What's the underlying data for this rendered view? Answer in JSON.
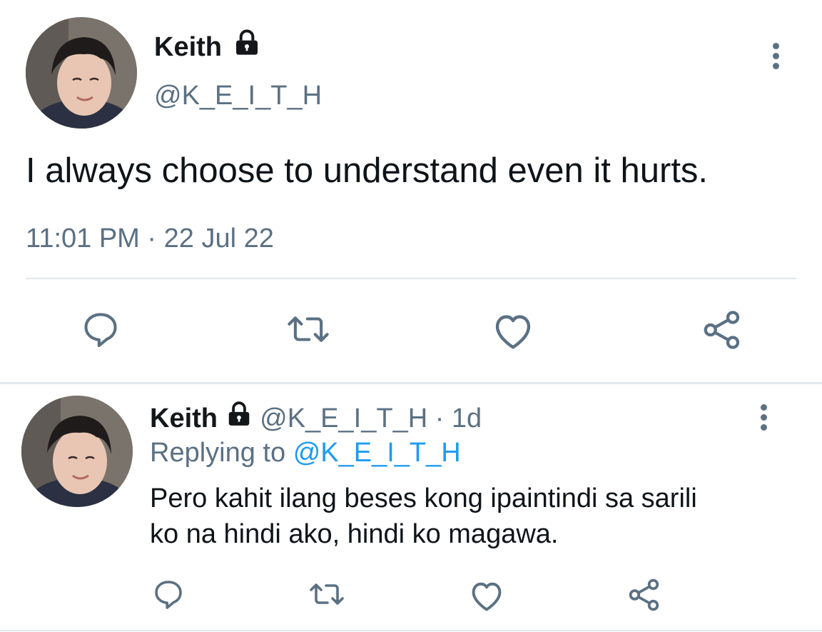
{
  "main_tweet": {
    "author_name": "Keith",
    "handle": "@K_E_I_T_H",
    "text": "I always choose to understand even it hurts.",
    "time": "11:01 PM",
    "separator": "·",
    "date": "22 Jul 22",
    "lock_icon": "lock-icon"
  },
  "reply_tweet": {
    "author_name": "Keith",
    "handle": "@K_E_I_T_H",
    "separator": "·",
    "age": "1d",
    "replying_prefix": "Replying to",
    "replying_handle": "@K_E_I_T_H",
    "text_line1": "Pero kahit ilang beses kong ipaintindi sa sarili",
    "text_line2": "ko na hindi ako, hindi ko magawa."
  },
  "actions": [
    "reply-icon",
    "retweet-icon",
    "like-icon",
    "share-icon"
  ],
  "colors": {
    "text": "#0f1419",
    "muted": "#5b7083",
    "link": "#1d9bf0",
    "divider": "#e1e8ed"
  }
}
